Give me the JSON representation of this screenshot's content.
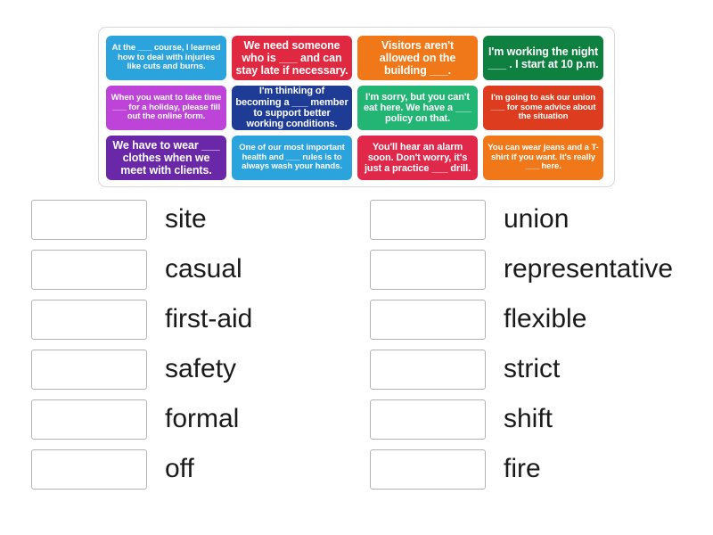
{
  "tile_bank": {
    "name": "sentence-tile-bank",
    "tiles": [
      {
        "text": "At the ___ course, I learned how to deal with injuries like cuts and burns.",
        "color": "#2BA4DE",
        "size": "t-sm"
      },
      {
        "text": "We need someone who is ___ and can stay late if necessary.",
        "color": "#E02841",
        "size": "t-lg"
      },
      {
        "text": "Visitors aren't allowed on the building ___.",
        "color": "#F07818",
        "size": "t-lg"
      },
      {
        "text": "I'm working the night ___ . I start at 10 p.m.",
        "color": "#0E8040",
        "size": "t-lg"
      },
      {
        "text": "When you want to take time ___ for a holiday, please fill out the online form.",
        "color": "#BE43D8",
        "size": "t-sm"
      },
      {
        "text": "I'm thinking of becoming a ___ member to support better working conditions.",
        "color": "#1E3C96",
        "size": "t-md"
      },
      {
        "text": "I'm sorry, but you can't eat here. We have a ___ policy on that.",
        "color": "#22B573",
        "size": "t-md"
      },
      {
        "text": "I'm going to ask our union ___ for some advice about the situation",
        "color": "#DD3C1E",
        "size": "t-sm"
      },
      {
        "text": "We have to wear ___ clothes when we meet with clients.",
        "color": "#6A28A8",
        "size": "t-lg"
      },
      {
        "text": "One of our most important health and ___ rules is to always wash your hands.",
        "color": "#2BA4DE",
        "size": "t-sm"
      },
      {
        "text": "You'll hear an alarm soon. Don't worry, it's just a practice ___ drill.",
        "color": "#E0284B",
        "size": "t-md"
      },
      {
        "text": "You can wear jeans and a T-shirt if you want. It's really ___ here.",
        "color": "#F07818",
        "size": "t-sm"
      }
    ]
  },
  "answers": {
    "left": [
      {
        "label": "site",
        "box_value": ""
      },
      {
        "label": "casual",
        "box_value": ""
      },
      {
        "label": "first-aid",
        "box_value": ""
      },
      {
        "label": "safety",
        "box_value": ""
      },
      {
        "label": "formal",
        "box_value": ""
      },
      {
        "label": "off",
        "box_value": ""
      }
    ],
    "right": [
      {
        "label": "union",
        "box_value": ""
      },
      {
        "label": "representative",
        "box_value": ""
      },
      {
        "label": "flexible",
        "box_value": ""
      },
      {
        "label": "strict",
        "box_value": ""
      },
      {
        "label": "shift",
        "box_value": ""
      },
      {
        "label": "fire",
        "box_value": ""
      }
    ]
  }
}
